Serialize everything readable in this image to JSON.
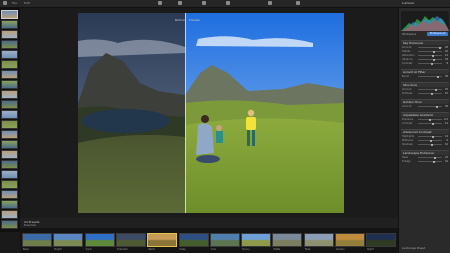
{
  "window": {
    "title": "Luminar"
  },
  "toolbar": {
    "left_labels": [
      "File",
      "Edit"
    ],
    "right_label": "Presets"
  },
  "canvas": {
    "before_label": "Before",
    "after_label": "Presets"
  },
  "panel": {
    "histogram": {
      "colors": [
        "#ffffff",
        "#3c8ee8",
        "#2fbf4f",
        "#d94444"
      ]
    },
    "workspace_label": "Workspace",
    "workspace_value": "Professional",
    "sections": [
      {
        "title": "Sky Enhancer",
        "rows": [
          {
            "label": "Amount",
            "value": "45"
          },
          {
            "label": "Details",
            "value": "20"
          },
          {
            "label": "Saturation",
            "value": "12"
          },
          {
            "label": "Vibrance",
            "value": "18"
          },
          {
            "label": "Contrast",
            "value": "8"
          }
        ]
      },
      {
        "title": "Accent AI Filter",
        "rows": [
          {
            "label": "Boost",
            "value": "36"
          }
        ]
      },
      {
        "title": "Structure",
        "rows": [
          {
            "label": "Amount",
            "value": "25"
          },
          {
            "label": "Softness",
            "value": "10"
          }
        ]
      },
      {
        "title": "Golden Hour",
        "rows": [
          {
            "label": "Amount",
            "value": "30"
          }
        ]
      },
      {
        "title": "Adjustable Gradient",
        "rows": [
          {
            "label": "Exposure",
            "value": "-0.5"
          },
          {
            "label": "Contrast",
            "value": "12"
          }
        ]
      },
      {
        "title": "Advanced Contrast",
        "rows": [
          {
            "label": "Highlights",
            "value": "14"
          },
          {
            "label": "Midtones",
            "value": "6"
          },
          {
            "label": "Shadows",
            "value": "10"
          }
        ]
      },
      {
        "title": "Landscape Enhancer",
        "rows": [
          {
            "label": "Haze",
            "value": "22"
          },
          {
            "label": "Foliage",
            "value": "16"
          }
        ]
      }
    ],
    "footer": "Landscape Preset"
  },
  "filmbar": {
    "category": "All Presets",
    "dropdown": "Essentials"
  },
  "filmstrip": {
    "items": [
      {
        "caption": "Basic",
        "colors": [
          "#3a6aa8",
          "#6e7d4a"
        ]
      },
      {
        "caption": "Bright",
        "colors": [
          "#5b88c4",
          "#7d8c55"
        ]
      },
      {
        "caption": "Vivid",
        "colors": [
          "#2e6fc8",
          "#5f8a3a"
        ]
      },
      {
        "caption": "Dramatic",
        "colors": [
          "#3c4a63",
          "#4e5a32"
        ]
      },
      {
        "caption": "Warm",
        "colors": [
          "#c79a57",
          "#8a7438"
        ]
      },
      {
        "caption": "Deep",
        "colors": [
          "#2d4f86",
          "#43602c"
        ]
      },
      {
        "caption": "Cool",
        "colors": [
          "#4f7fae",
          "#5c7450"
        ]
      },
      {
        "caption": "Sunny",
        "colors": [
          "#6f9fd8",
          "#8e9a48"
        ]
      },
      {
        "caption": "Matte",
        "colors": [
          "#7a8a9a",
          "#7d7d5f"
        ]
      },
      {
        "caption": "Fade",
        "colors": [
          "#8c9fb6",
          "#8e9170"
        ]
      },
      {
        "caption": "Golden",
        "colors": [
          "#c08b3c",
          "#93803a"
        ]
      },
      {
        "caption": "Night",
        "colors": [
          "#1f2f4f",
          "#2f3a22"
        ]
      }
    ]
  },
  "leftstrip": {
    "count": 22
  }
}
